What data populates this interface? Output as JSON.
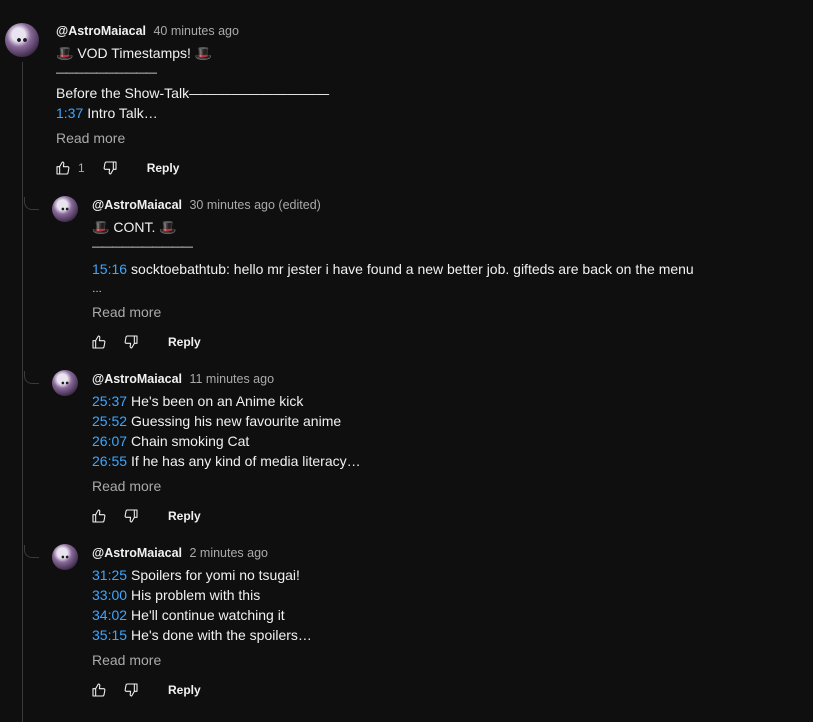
{
  "comments": [
    {
      "author": "@AstroMaiacal",
      "time": "40 minutes ago",
      "hat_left": "🎩",
      "title": "VOD Timestamps!",
      "hat_right": "🎩",
      "separator": "——————————",
      "line2": "Before the Show-Talk——————————",
      "entries": [
        {
          "ts": "1:37",
          "text": "Intro Talk…"
        }
      ],
      "read_more": "Read more",
      "likes": "1",
      "reply_label": "Reply"
    },
    {
      "author": "@AstroMaiacal",
      "time": "30 minutes ago (edited)",
      "hat_left": "🎩",
      "title": "CONT.",
      "hat_right": "🎩",
      "separator": "——————————",
      "entries": [
        {
          "ts": "15:16",
          "text": "socktoebathtub: hello mr jester i have found a new better job. gifteds are back on the menu"
        }
      ],
      "trailing": "…",
      "read_more": "Read more",
      "reply_label": "Reply"
    },
    {
      "author": "@AstroMaiacal",
      "time": "11 minutes ago",
      "entries": [
        {
          "ts": "25:37",
          "text": "He's been on an Anime kick"
        },
        {
          "ts": "25:52",
          "text": "Guessing his new favourite anime"
        },
        {
          "ts": "26:07",
          "text": "Chain smoking Cat"
        },
        {
          "ts": "26:55",
          "text": "If he has any kind of media literacy…"
        }
      ],
      "read_more": "Read more",
      "reply_label": "Reply"
    },
    {
      "author": "@AstroMaiacal",
      "time": "2 minutes ago",
      "entries": [
        {
          "ts": "31:25",
          "text": "Spoilers for yomi no tsugai!"
        },
        {
          "ts": "33:00",
          "text": "His problem with this"
        },
        {
          "ts": "34:02",
          "text": "He'll continue watching it"
        },
        {
          "ts": "35:15",
          "text": "He's done with the spoilers…"
        }
      ],
      "read_more": "Read more",
      "reply_label": "Reply"
    }
  ],
  "icons": {
    "like": "thumbs-up-icon",
    "dislike": "thumbs-down-icon"
  },
  "colors": {
    "background": "#0f0f0f",
    "timestamp_link": "#3ea6ff",
    "secondary_text": "#aaaaaa"
  }
}
